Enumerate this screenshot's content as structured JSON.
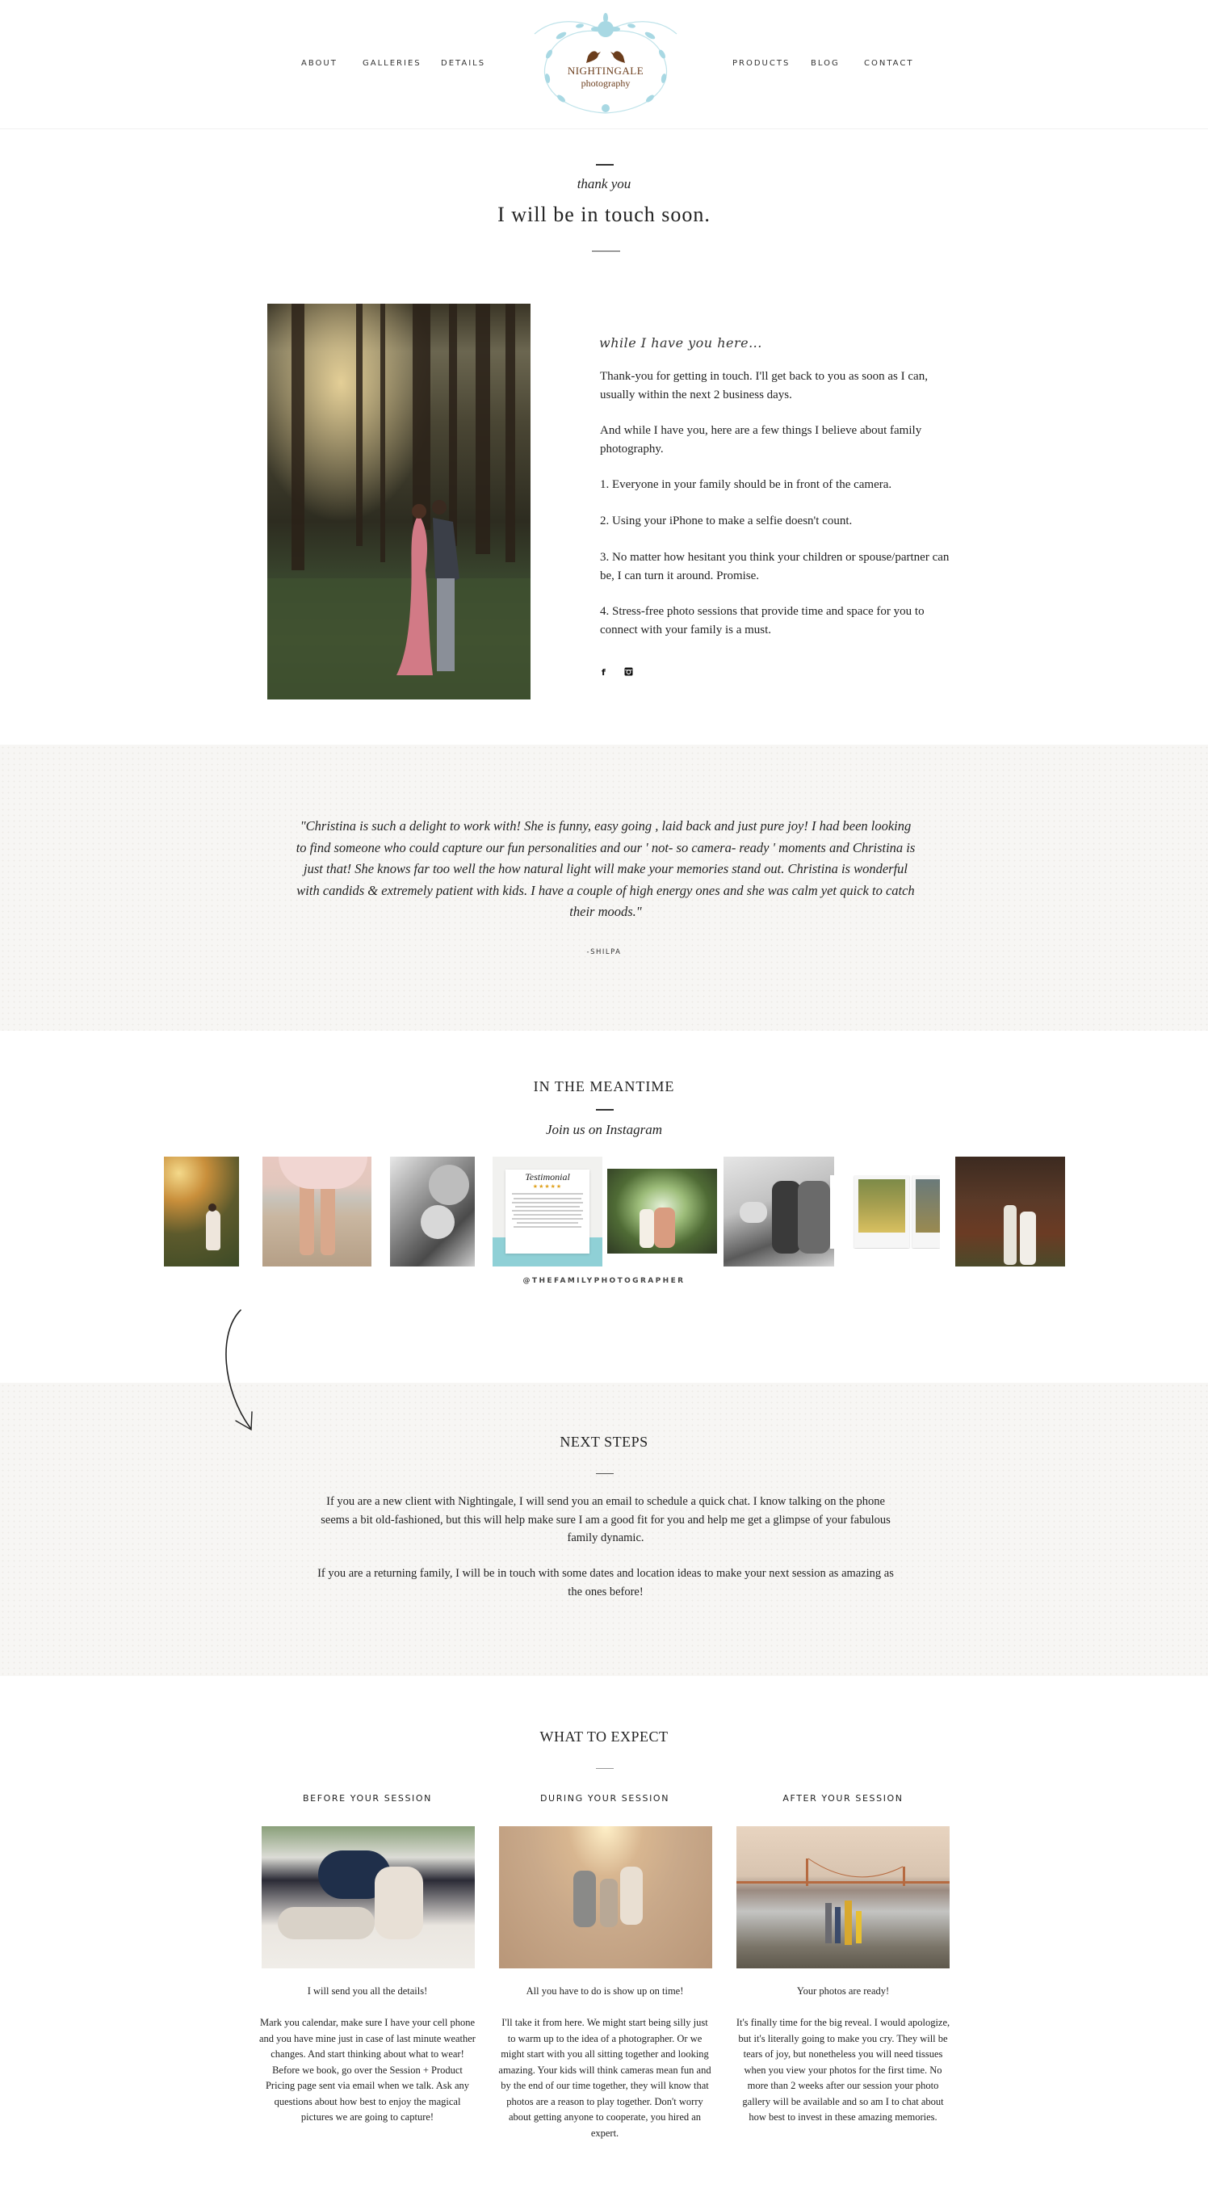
{
  "header": {
    "nav_left": [
      "ABOUT",
      "GALLERIES",
      "DETAILS"
    ],
    "nav_right": [
      "PRODUCTS",
      "BLOG",
      "CONTACT"
    ],
    "logo": {
      "line1": "NIGHTINGALE",
      "line2": "photography"
    },
    "colors": {
      "logo_brown": "#6b3d1c",
      "logo_blue": "#a8d8e3"
    }
  },
  "hero": {
    "kicker": "thank you",
    "title": "I will be in touch soon."
  },
  "intro": {
    "script_heading": "while I have you here...",
    "paragraphs": [
      "Thank-you for getting in touch. I'll get back to you as soon as I can, usually within the next 2 business days.",
      "And while I have you, here are a few things I believe about family photography.",
      "1. Everyone in your family should be in front of the camera.",
      "2. Using your iPhone to make a selfie doesn't count.",
      "3. No matter how hesitant you think your children or spouse/partner can be, I can turn it around. Promise.",
      "4. Stress-free photo sessions that provide time and space for you to connect with your family is a must."
    ],
    "social": {
      "facebook": "f",
      "instagram": "instagram"
    },
    "photo_alt": "Couple in redwood forest"
  },
  "testimonial": {
    "quote": "\"Christina is such a delight to work with! She is funny, easy going , laid back and just pure joy! I had been looking to find someone who could capture our fun personalities and our ' not- so camera- ready ' moments and Christina is just that! She knows far too well the how natural light will make your memories stand out. Christina is wonderful with candids & extremely patient with kids. I have a couple of high energy ones and she was calm yet quick to catch their moods.\"",
    "author": "-SHILPA"
  },
  "instagram": {
    "title": "IN THE MEANTIME",
    "subtitle": "Join us on Instagram",
    "handle": "@THEFAMILYPHOTOGRAPHER",
    "testimonial_tile": {
      "title": "Testimonial",
      "stars": "★★★★★"
    },
    "tiles": [
      "maternity-sunset",
      "beach-feet",
      "newborn-bw",
      "testimonial-card",
      "mother-daughter-garden",
      "family-bw",
      "polaroid-wildflowers",
      "couple-forest"
    ]
  },
  "next_steps": {
    "title": "NEXT STEPS",
    "paragraphs": [
      "If you are a new client with Nightingale, I will send you an email to schedule a quick chat. I know talking on the phone seems a bit old-fashioned, but this will help make sure I am a good fit for you and help me get a glimpse of your fabulous family dynamic.",
      "If you are a returning family, I will be in touch with some dates and location ideas to make your next session as amazing as the ones before!"
    ]
  },
  "what_to_expect": {
    "title": "WHAT TO EXPECT",
    "columns": [
      {
        "heading": "BEFORE YOUR SESSION",
        "lead": "I will send you all the details!",
        "body": "Mark you calendar, make sure I have your cell phone and you have mine just in case of last minute weather changes. And start thinking about what to wear! Before we book, go over the Session + Product Pricing page sent via email when we talk. Ask any questions about how best to enjoy the magical pictures we are going to capture!"
      },
      {
        "heading": "DURING YOUR SESSION",
        "lead": "All you have to do is show up on time!",
        "body": "I'll take it from here. We might start being silly just to warm up to the idea of a photographer. Or we might start with you all sitting together and looking amazing. Your kids will think cameras mean fun and by the end of our time together, they will know that photos are a reason to play together. Don't worry about getting anyone to cooperate, you hired an expert."
      },
      {
        "heading": "AFTER YOUR SESSION",
        "lead": "Your photos are ready!",
        "body": "It's finally time for the big reveal. I would apologize, but it's literally going to make you cry. They will be tears of joy, but nonetheless you will need tissues when you view your photos for the first time. No more than 2 weeks after our session your photo gallery will be available and so am I to chat about how best to invest in these amazing memories."
      }
    ]
  }
}
